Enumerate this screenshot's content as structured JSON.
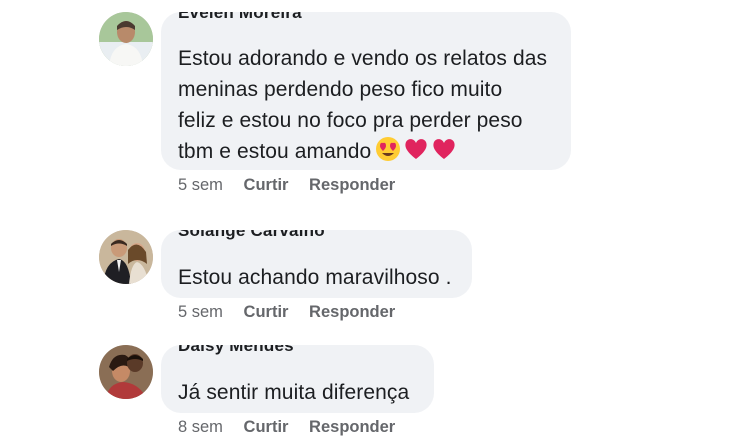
{
  "comments": [
    {
      "author": "Evelen Moreira",
      "lines": [
        "Estou adorando e vendo os relatos das",
        "meninas perdendo peso fico muito",
        "feliz e estou no foco pra perder peso",
        "tbm e estou amando"
      ],
      "emojis": [
        "heart-eyes-emoji",
        "red-heart-emoji",
        "red-heart-emoji"
      ],
      "time": "5 sem",
      "like_label": "Curtir",
      "reply_label": "Responder"
    },
    {
      "author": "Solange Carvalho",
      "lines": [
        "Estou achando maravilhoso ."
      ],
      "time": "5 sem",
      "like_label": "Curtir",
      "reply_label": "Responder"
    },
    {
      "author": "Daisy Mendes",
      "lines": [
        "Já sentir muita diferença"
      ],
      "time": "8 sem",
      "like_label": "Curtir",
      "reply_label": "Responder"
    }
  ],
  "colors": {
    "bubble": "#f0f2f5",
    "text": "#1c1e21",
    "meta": "#65676b",
    "heart": "#e0245e"
  }
}
